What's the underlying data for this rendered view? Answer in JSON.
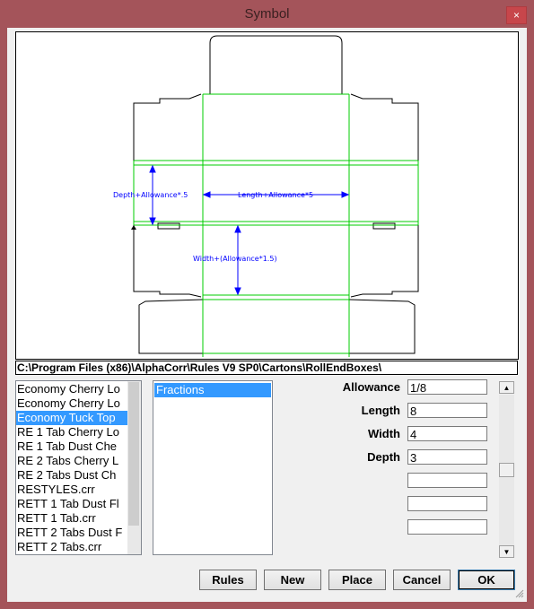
{
  "window": {
    "title": "Symbol",
    "close_glyph": "×"
  },
  "preview": {
    "labels": {
      "depth": "Depth+Allowance*.5",
      "length": "Length+Allowance*5",
      "width": "Width+(Allowance*1.5)"
    },
    "line_color": "#00cc00",
    "dim_color": "#0000ff"
  },
  "path": "C:\\Program Files (x86)\\AlphaCorr\\Rules V9 SP0\\Cartons\\RollEndBoxes\\",
  "files": [
    {
      "label": "Economy Cherry Lo"
    },
    {
      "label": "Economy Cherry Lo"
    },
    {
      "label": "Economy Tuck Top"
    },
    {
      "label": "RE 1 Tab Cherry Lo"
    },
    {
      "label": "RE 1 Tab Dust Che"
    },
    {
      "label": "RE 2 Tabs Cherry L"
    },
    {
      "label": "RE 2 Tabs Dust Ch"
    },
    {
      "label": "RESTYLES.crr"
    },
    {
      "label": "RETT 1 Tab Dust Fl"
    },
    {
      "label": "RETT 1 Tab.crr"
    },
    {
      "label": "RETT 2 Tabs Dust F"
    },
    {
      "label": "RETT 2 Tabs.crr"
    }
  ],
  "selected_file_index": 2,
  "units": {
    "selected": "Fractions"
  },
  "params": [
    {
      "label": "Allowance",
      "value": "1/8"
    },
    {
      "label": "Length",
      "value": "8"
    },
    {
      "label": "Width",
      "value": "4"
    },
    {
      "label": "Depth",
      "value": "3"
    },
    {
      "label": "",
      "value": ""
    },
    {
      "label": "",
      "value": ""
    },
    {
      "label": "",
      "value": ""
    }
  ],
  "scroll": {
    "up": "▲",
    "down": "▼"
  },
  "buttons": {
    "rules": "Rules",
    "new": "New",
    "place": "Place",
    "cancel": "Cancel",
    "ok": "OK"
  }
}
